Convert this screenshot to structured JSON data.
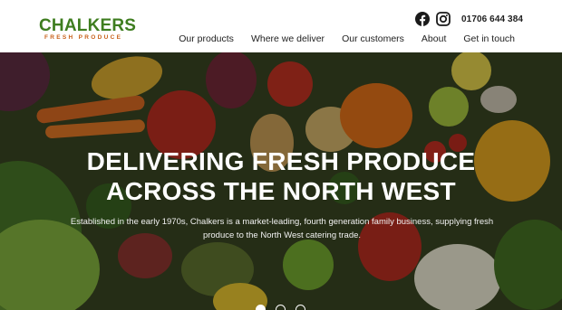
{
  "brand": {
    "name": "CHALKERS",
    "tagline": "FRESH PRODUCE"
  },
  "header": {
    "phone": "01706 644 384",
    "social": [
      {
        "icon": "facebook-icon"
      },
      {
        "icon": "instagram-icon"
      }
    ]
  },
  "nav": {
    "items": [
      {
        "label": "Our products"
      },
      {
        "label": "Where we deliver"
      },
      {
        "label": "Our customers"
      },
      {
        "label": "About"
      },
      {
        "label": "Get in touch"
      }
    ]
  },
  "hero": {
    "title_line1": "DELIVERING FRESH PRODUCE",
    "title_line2": "ACROSS THE NORTH WEST",
    "text": "Established in the early 1970s, Chalkers is a market-leading, fourth generation family business, supplying fresh produce to the North West catering trade.",
    "slides": [
      {
        "active": true
      },
      {
        "active": false
      },
      {
        "active": false
      }
    ]
  },
  "colors": {
    "brand_green": "#3e7d1f",
    "brand_orange": "#c8601a",
    "text_dark": "#222222",
    "hero_text": "#ffffff"
  }
}
